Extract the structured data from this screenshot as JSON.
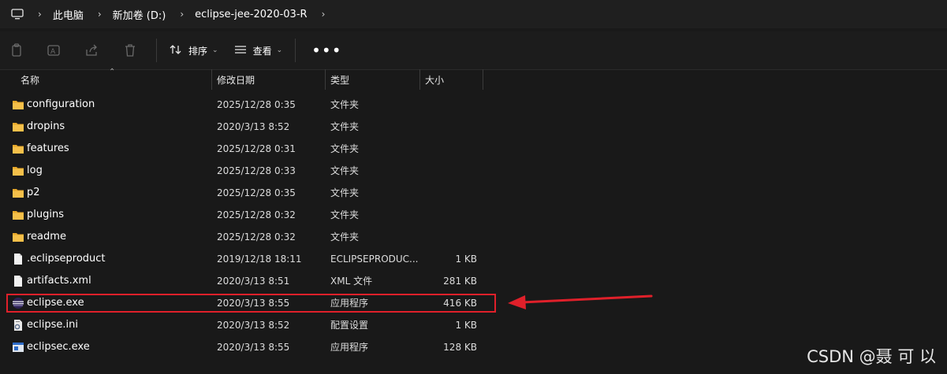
{
  "breadcrumb": [
    "此电脑",
    "新加卷 (D:)",
    "eclipse-jee-2020-03-R"
  ],
  "toolbar": {
    "sort_label": "排序",
    "view_label": "查看",
    "more_label": "•••"
  },
  "columns": {
    "name": "名称",
    "modified": "修改日期",
    "type": "类型",
    "size": "大小"
  },
  "files": [
    {
      "name": "configuration",
      "date": "2025/12/28 0:35",
      "type": "文件夹",
      "size": "",
      "icon": "folder-icon"
    },
    {
      "name": "dropins",
      "date": "2020/3/13 8:52",
      "type": "文件夹",
      "size": "",
      "icon": "folder-icon"
    },
    {
      "name": "features",
      "date": "2025/12/28 0:31",
      "type": "文件夹",
      "size": "",
      "icon": "folder-icon"
    },
    {
      "name": "log",
      "date": "2025/12/28 0:33",
      "type": "文件夹",
      "size": "",
      "icon": "folder-icon"
    },
    {
      "name": "p2",
      "date": "2025/12/28 0:35",
      "type": "文件夹",
      "size": "",
      "icon": "folder-icon"
    },
    {
      "name": "plugins",
      "date": "2025/12/28 0:32",
      "type": "文件夹",
      "size": "",
      "icon": "folder-icon"
    },
    {
      "name": "readme",
      "date": "2025/12/28 0:32",
      "type": "文件夹",
      "size": "",
      "icon": "folder-icon"
    },
    {
      "name": ".eclipseproduct",
      "date": "2019/12/18 18:11",
      "type": "ECLIPSEPRODUC...",
      "size": "1 KB",
      "icon": "file-icon"
    },
    {
      "name": "artifacts.xml",
      "date": "2020/3/13 8:51",
      "type": "XML 文件",
      "size": "281 KB",
      "icon": "file-icon"
    },
    {
      "name": "eclipse.exe",
      "date": "2020/3/13 8:55",
      "type": "应用程序",
      "size": "416 KB",
      "icon": "eclipse-icon"
    },
    {
      "name": "eclipse.ini",
      "date": "2020/3/13 8:52",
      "type": "配置设置",
      "size": "1 KB",
      "icon": "settings-file-icon"
    },
    {
      "name": "eclipsec.exe",
      "date": "2020/3/13 8:55",
      "type": "应用程序",
      "size": "128 KB",
      "icon": "exe-icon"
    }
  ],
  "highlighted_file": "eclipse.exe",
  "colors": {
    "highlight": "#e0202a",
    "folder": "#f5c04a",
    "background": "#191919"
  },
  "watermark": "CSDN @聂 可 以"
}
